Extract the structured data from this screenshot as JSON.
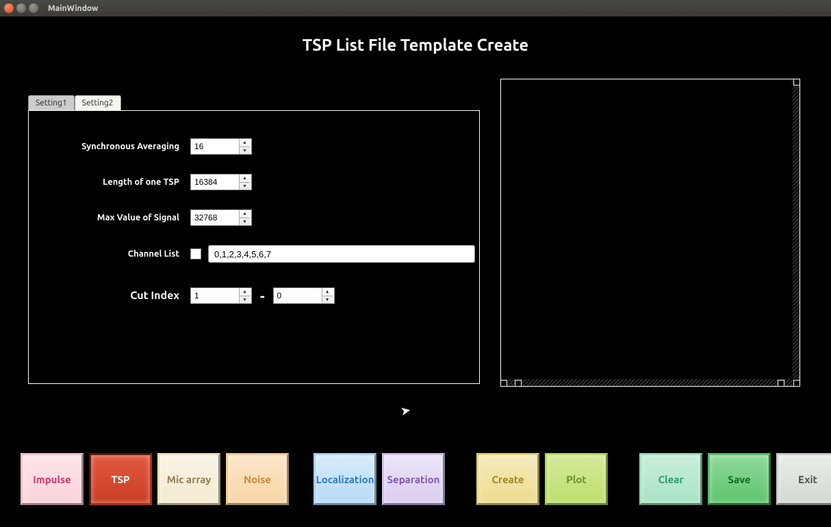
{
  "window_title": "MainWindow",
  "page_title": "TSP List File Template Create",
  "tabs": {
    "tab1": "Setting1",
    "tab2": "Setting2"
  },
  "form": {
    "sync_avg_label": "Synchronous Averaging",
    "sync_avg_value": "16",
    "tsp_len_label": "Length of one TSP",
    "tsp_len_value": "16384",
    "max_sig_label": "Max Value of Signal",
    "max_sig_value": "32768",
    "channel_list_label": "Channel List",
    "channel_list_value": "0,1,2,3,4,5,6,7",
    "cut_index_label": "Cut Index",
    "cut_index_start": "1",
    "cut_index_sep": "-",
    "cut_index_end": "0"
  },
  "buttons": {
    "impulse": "Impulse",
    "tsp": "TSP",
    "micarray": "Mic array",
    "noise": "Noise",
    "localization": "Localization",
    "separation": "Separation",
    "create": "Create",
    "plot": "Plot",
    "clear": "Clear",
    "save": "Save",
    "exit": "Exit"
  }
}
